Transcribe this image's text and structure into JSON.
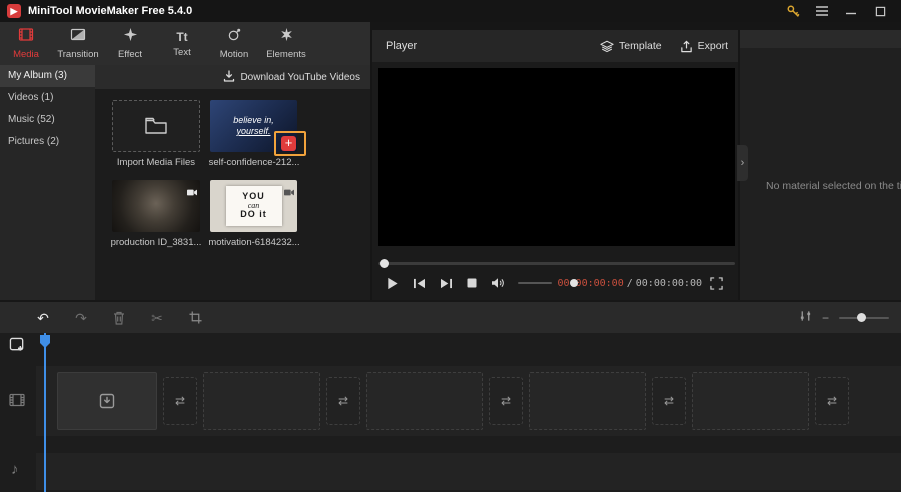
{
  "titlebar": {
    "title": "MiniTool MovieMaker Free 5.4.0"
  },
  "ribbon": {
    "tabs": [
      {
        "label": "Media",
        "active": true
      },
      {
        "label": "Transition",
        "active": false
      },
      {
        "label": "Effect",
        "active": false
      },
      {
        "label": "Text",
        "active": false
      },
      {
        "label": "Motion",
        "active": false
      },
      {
        "label": "Elements",
        "active": false
      }
    ]
  },
  "sidebar": {
    "items": [
      {
        "label": "My Album (3)",
        "selected": true
      },
      {
        "label": "Videos (1)",
        "selected": false
      },
      {
        "label": "Music (52)",
        "selected": false
      },
      {
        "label": "Pictures (2)",
        "selected": false
      }
    ]
  },
  "library": {
    "download_label": "Download YouTube Videos",
    "import_label": "Import Media Files",
    "items": [
      {
        "name": "self-confidence-212...",
        "thumb_line1": "believe in,",
        "thumb_line2": "yourself."
      },
      {
        "name": "production ID_3831..."
      },
      {
        "name": "motivation-6184232...",
        "thumb_line1": "YOU",
        "thumb_line2": "can",
        "thumb_line3": "DO it"
      }
    ]
  },
  "player": {
    "title": "Player",
    "template_label": "Template",
    "export_label": "Export",
    "current_time": "00:00:00:00",
    "time_separator": "/",
    "duration": "00:00:00:00"
  },
  "property_panel": {
    "empty_text": "No material selected on the timeline"
  },
  "timeline": {
    "slots": [
      {
        "kind": "clip",
        "first": true
      },
      {
        "kind": "transition"
      },
      {
        "kind": "clip"
      },
      {
        "kind": "transition"
      },
      {
        "kind": "clip"
      },
      {
        "kind": "transition"
      },
      {
        "kind": "clip"
      },
      {
        "kind": "transition"
      },
      {
        "kind": "clip"
      },
      {
        "kind": "transition"
      }
    ]
  },
  "icons": {
    "transition_arrows": "⇄",
    "music_note": "♪",
    "undo": "↶",
    "redo": "↷",
    "scissors": "✂",
    "collapse_arrow": "›",
    "text_tab": "Tt",
    "plus": "+",
    "minus": "−",
    "logo_glyph": "▶"
  },
  "colors": {
    "accent_red": "#e23b3b",
    "plus_button_red": "#e03c3c",
    "highlight_orange": "#f2a33c",
    "playhead_blue": "#3f8fe8",
    "time_red": "#c94f3d"
  }
}
